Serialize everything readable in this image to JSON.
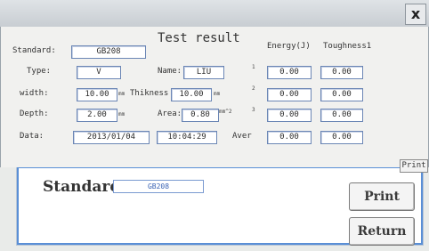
{
  "background": {
    "standard_label": "Standard:",
    "standard_value": "GB208",
    "print_label": "Print",
    "return_label": "Return"
  },
  "dialog": {
    "close_label": "x",
    "title": "Test result",
    "labels": {
      "standard": "Standard:",
      "type": "Type:",
      "name": "Name:",
      "width": "width:",
      "thickness": "Thikness",
      "depth": "Depth:",
      "area": "Area:",
      "date": "Data:",
      "aver": "Aver",
      "energy_header": "Energy(J)",
      "toughness_header": "Toughness1"
    },
    "units": {
      "mm1": "mm",
      "mm2": "mm",
      "mm3": "mm",
      "mm2_area": "mm^2"
    },
    "fields": {
      "standard": "GB208",
      "type": "V",
      "name": "LIU",
      "width": "10.00",
      "thickness": "10.00",
      "depth": "2.00",
      "area": "0.80",
      "date": "2013/01/04",
      "time": "10:04:29"
    },
    "results": [
      {
        "marker": "1",
        "energy": "0.00",
        "toughness": "0.00"
      },
      {
        "marker": "2",
        "energy": "0.00",
        "toughness": "0.00"
      },
      {
        "marker": "3",
        "energy": "0.00",
        "toughness": "0.00"
      }
    ],
    "average": {
      "energy": "0.00",
      "toughness": "0.00"
    },
    "print_label": "Print"
  }
}
